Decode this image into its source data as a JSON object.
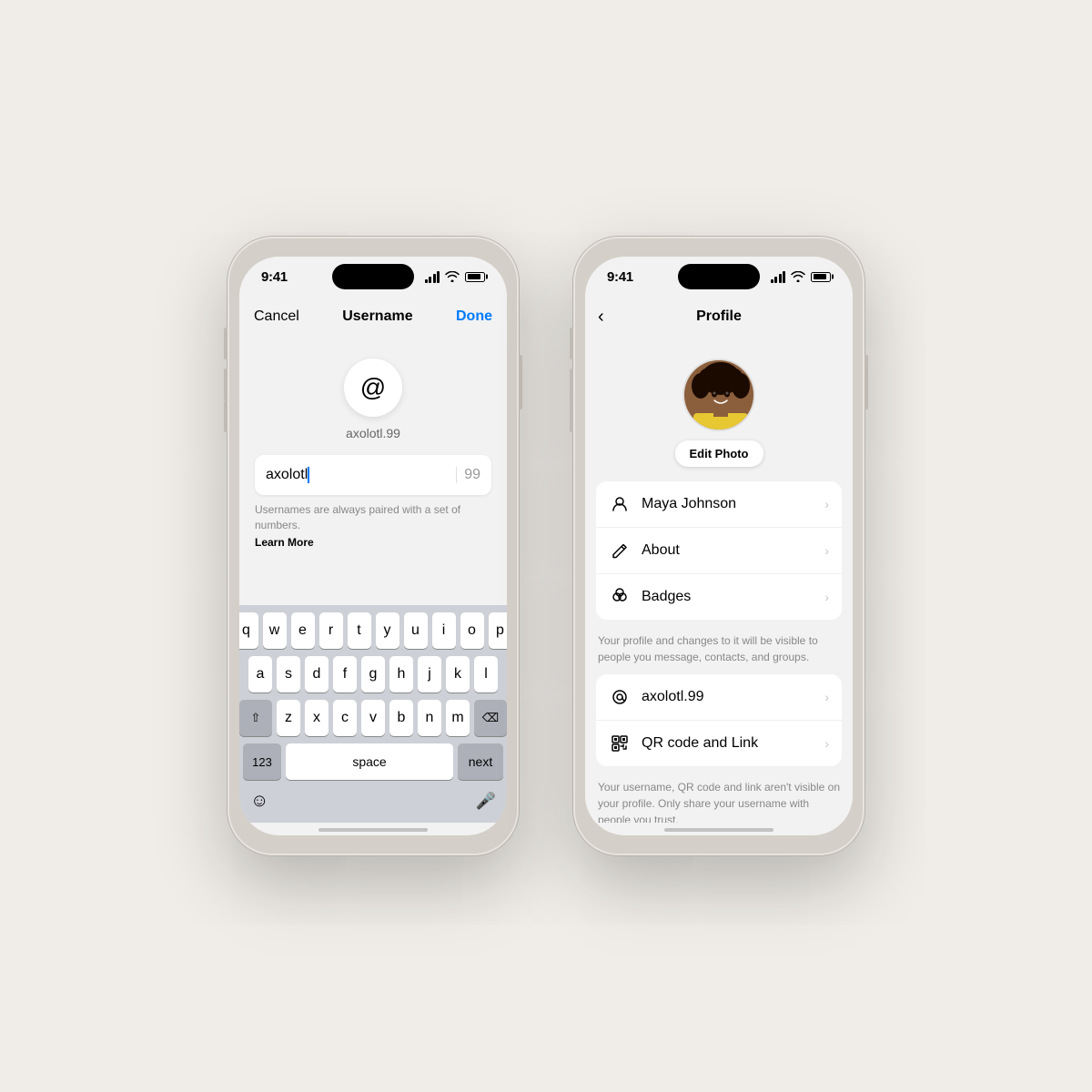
{
  "phone1": {
    "status_time": "9:41",
    "nav": {
      "cancel": "Cancel",
      "title": "Username",
      "done": "Done"
    },
    "at_label": "axolotl.99",
    "input_value": "axolotl",
    "number_suffix": "99",
    "hint": "Usernames are always paired with a set of numbers.",
    "learn_more": "Learn More",
    "keyboard": {
      "row1": [
        "q",
        "w",
        "e",
        "r",
        "t",
        "y",
        "u",
        "i",
        "o",
        "p"
      ],
      "row2": [
        "a",
        "s",
        "d",
        "f",
        "g",
        "h",
        "j",
        "k",
        "l"
      ],
      "row3": [
        "z",
        "x",
        "c",
        "v",
        "b",
        "n",
        "m"
      ],
      "space_label": "space",
      "next_label": "next",
      "num_label": "123"
    }
  },
  "phone2": {
    "status_time": "9:41",
    "nav": {
      "back_icon": "‹",
      "title": "Profile"
    },
    "edit_photo_label": "Edit Photo",
    "profile_items": [
      {
        "id": "name",
        "icon": "person",
        "label": "Maya Johnson"
      },
      {
        "id": "about",
        "icon": "pencil",
        "label": "About"
      },
      {
        "id": "badges",
        "icon": "badges",
        "label": "Badges"
      }
    ],
    "profile_footer": "Your profile and changes to it will be visible to people you message, contacts, and groups.",
    "username_items": [
      {
        "id": "username",
        "icon": "at",
        "label": "axolotl.99"
      },
      {
        "id": "qr",
        "icon": "qr",
        "label": "QR code and Link"
      }
    ],
    "username_footer": "Your username, QR code and link aren't visible on your profile. Only share your username with people you trust."
  }
}
